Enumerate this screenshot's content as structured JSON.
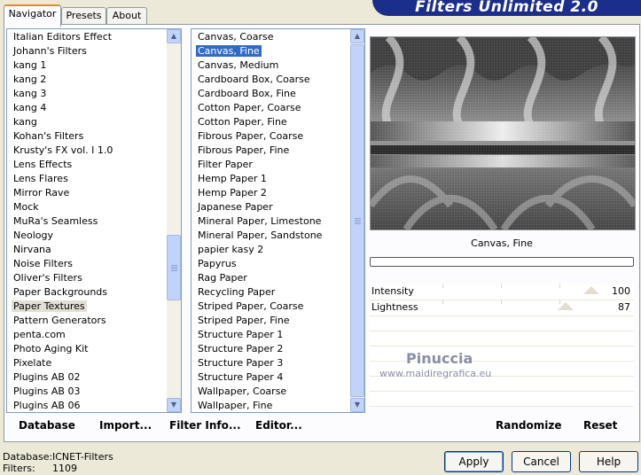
{
  "app": {
    "title": "Filters Unlimited 2.0"
  },
  "tabs": [
    {
      "label": "Navigator"
    },
    {
      "label": "Presets"
    },
    {
      "label": "About"
    }
  ],
  "categories": {
    "items": [
      "Italian Editors Effect",
      "Johann's Filters",
      "kang 1",
      "kang 2",
      "kang 3",
      "kang 4",
      "kang",
      "Kohan's Filters",
      "Krusty's FX vol. I 1.0",
      "Lens Effects",
      "Lens Flares",
      "Mirror Rave",
      "Mock",
      "MuRa's Seamless",
      "Neology",
      "Nirvana",
      "Noise Filters",
      "Oliver's Filters",
      "Paper Backgrounds",
      "Paper Textures",
      "Pattern Generators",
      "penta.com",
      "Photo Aging Kit",
      "Pixelate",
      "Plugins AB 02",
      "Plugins AB 03",
      "Plugins AB 06"
    ],
    "selected": "Paper Textures"
  },
  "filters": {
    "items": [
      "Canvas, Coarse",
      "Canvas, Fine",
      "Canvas, Medium",
      "Cardboard Box, Coarse",
      "Cardboard Box, Fine",
      "Cotton Paper, Coarse",
      "Cotton Paper, Fine",
      "Fibrous Paper, Coarse",
      "Fibrous Paper, Fine",
      "Filter Paper",
      "Hemp Paper 1",
      "Hemp Paper 2",
      "Japanese Paper",
      "Mineral Paper, Limestone",
      "Mineral Paper, Sandstone",
      "papier kasy 2",
      "Papyrus",
      "Rag Paper",
      "Recycling Paper",
      "Striped Paper, Coarse",
      "Striped Paper, Fine",
      "Structure Paper 1",
      "Structure Paper 2",
      "Structure Paper 3",
      "Structure Paper 4",
      "Wallpaper, Coarse",
      "Wallpaper, Fine"
    ],
    "selected": "Canvas, Fine"
  },
  "preview": {
    "filter_name": "Canvas, Fine",
    "watermark": "Pinuccia",
    "watermark_url": "www.maidiregrafica.eu"
  },
  "params": [
    {
      "label": "Intensity",
      "value": "100",
      "level": 100
    },
    {
      "label": "Lightness",
      "value": "87",
      "level": 87
    }
  ],
  "toolbar": {
    "database": "Database",
    "import": "Import...",
    "filter_info": "Filter Info...",
    "editor": "Editor...",
    "randomize": "Randomize",
    "reset": "Reset"
  },
  "status": {
    "database_label": "Database:",
    "database_value": "ICNET-Filters",
    "filters_label": "Filters:",
    "filters_value": "1109"
  },
  "buttons": {
    "apply": "Apply",
    "cancel": "Cancel",
    "help": "Help"
  },
  "colors": {
    "selection": "#316ac5",
    "banner": "#1c2e8c",
    "tab_accent": "#e68b2c"
  }
}
